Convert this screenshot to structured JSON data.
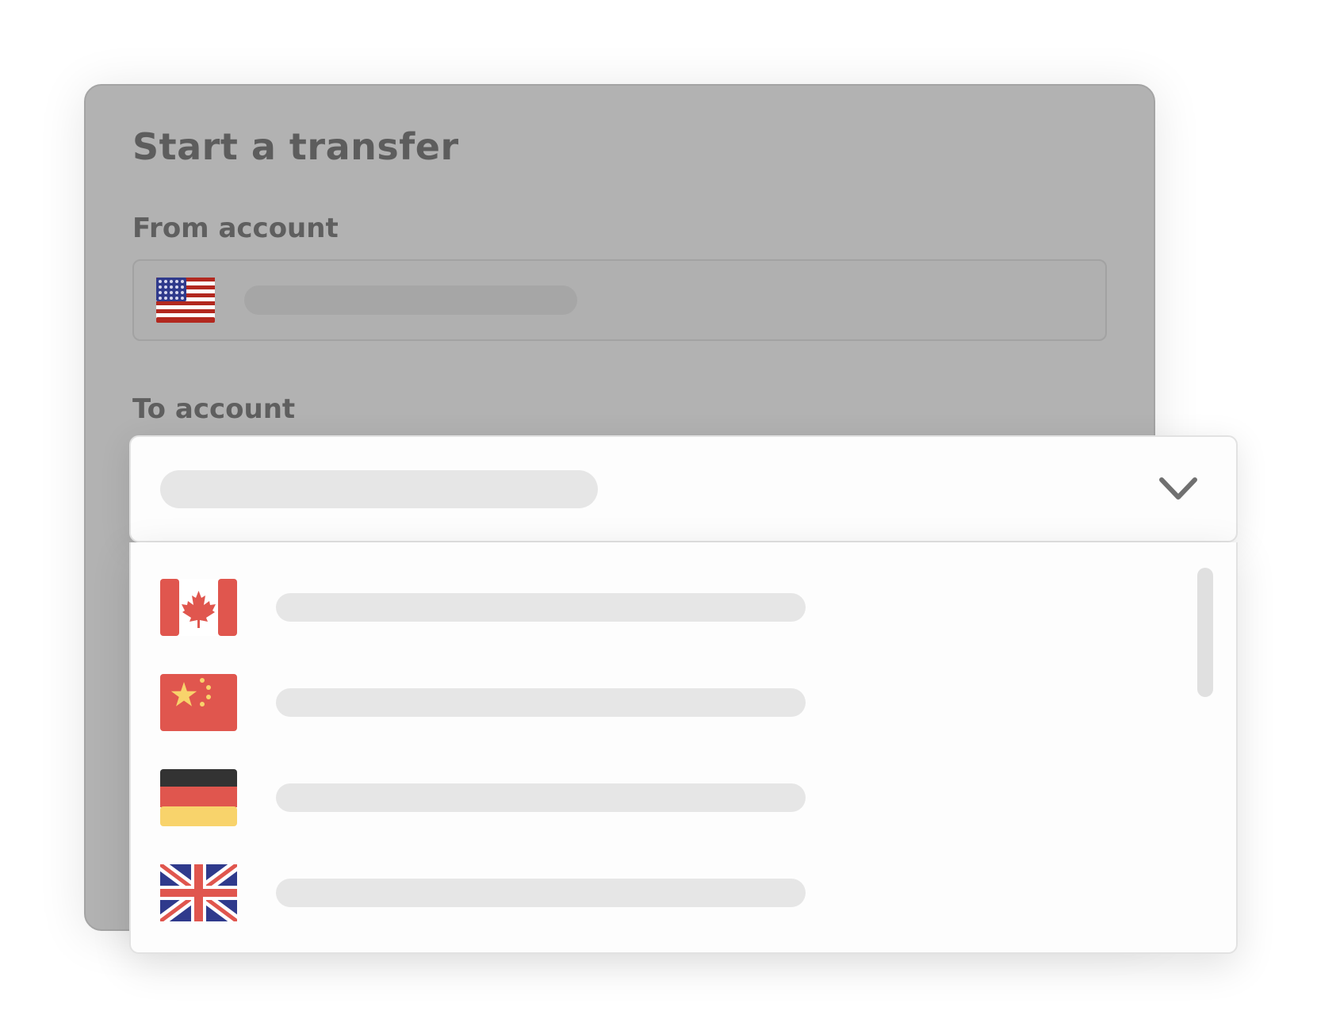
{
  "card": {
    "title": "Start a transfer",
    "from_label": "From account",
    "to_label": "To account",
    "from_account": {
      "flag": "us-flag-icon"
    }
  },
  "to_select": {
    "open": true,
    "chevron": "chevron-down-icon",
    "options": [
      {
        "flag": "canada-flag-icon"
      },
      {
        "flag": "china-flag-icon"
      },
      {
        "flag": "germany-flag-icon"
      },
      {
        "flag": "uk-flag-icon"
      }
    ]
  },
  "colors": {
    "overlay_card": "#b2b2b2",
    "dropdown_bg": "#fdfdfd",
    "skeleton": "#e6e6e6",
    "flag_red": "#e0564e",
    "flag_yellow": "#f8d36b"
  }
}
